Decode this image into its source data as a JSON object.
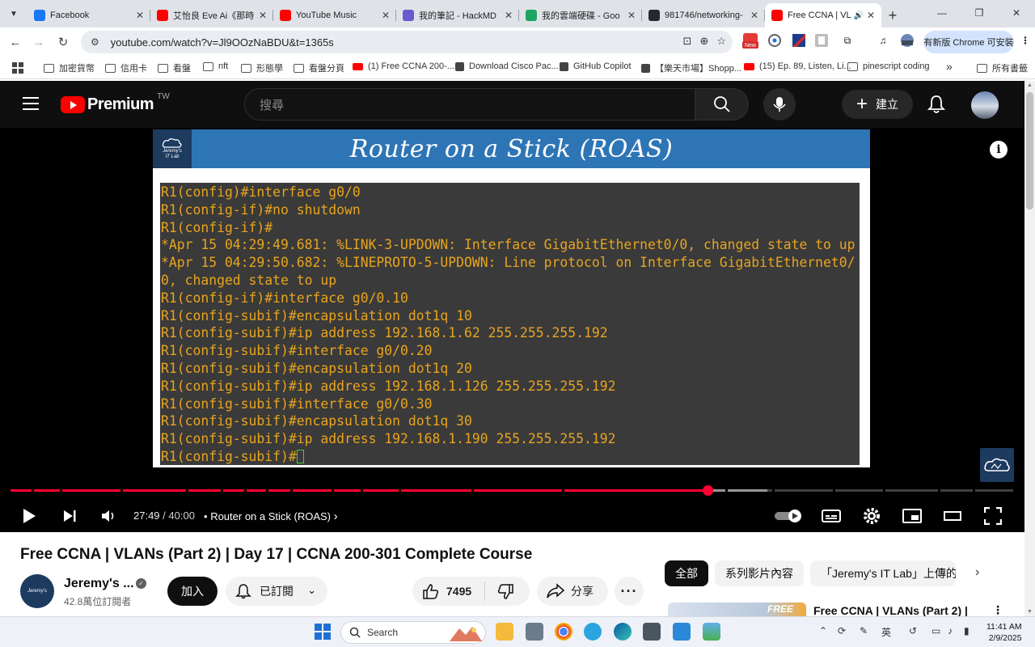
{
  "browser": {
    "tabs": [
      {
        "title": "Facebook",
        "icon": "facebook-icon",
        "color": "#1877f2"
      },
      {
        "title": "艾怡良 Eve Ai《那時",
        "icon": "youtube-icon",
        "color": "#ff0000"
      },
      {
        "title": "YouTube Music",
        "icon": "youtube-music-icon",
        "color": "#ff0000"
      },
      {
        "title": "我的筆記 - HackMD",
        "icon": "hackmd-icon",
        "color": "#6a5acd"
      },
      {
        "title": "我的雲端硬碟 - Goo",
        "icon": "google-drive-icon",
        "color": "#1fa463"
      },
      {
        "title": "981746/networking-",
        "icon": "github-icon",
        "color": "#24292f"
      },
      {
        "title": "Free CCNA | VLAN",
        "icon": "youtube-icon",
        "color": "#ff0000"
      }
    ],
    "url": "youtube.com/watch?v=Jl9OOzNaBDU&t=1365s",
    "update_button": "有新版 Chrome 可安裝",
    "ext_new_badge": "New",
    "bookmarks": [
      {
        "label": "加密貨幣",
        "type": "folder"
      },
      {
        "label": "信用卡",
        "type": "folder"
      },
      {
        "label": "看盤",
        "type": "folder"
      },
      {
        "label": "nft",
        "type": "folder"
      },
      {
        "label": "形態學",
        "type": "folder"
      },
      {
        "label": "看盤分頁",
        "type": "folder"
      },
      {
        "label": "(1) Free CCNA 200-...",
        "type": "youtube"
      },
      {
        "label": "Download Cisco Pac...",
        "type": "site"
      },
      {
        "label": "GitHub Copilot",
        "type": "site"
      },
      {
        "label": "【樂天市場】Shopp...",
        "type": "site"
      },
      {
        "label": "(15) Ep. 89, Listen, Li...",
        "type": "youtube"
      },
      {
        "label": "pinescript coding",
        "type": "folder"
      }
    ],
    "bookmarks_more": "»",
    "all_bookmarks": "所有書籤"
  },
  "youtube": {
    "logo_text": "Premium",
    "country_code": "TW",
    "search_placeholder": "搜尋",
    "create_label": "建立",
    "slide": {
      "logo_line1": "Jeremy's",
      "logo_line2": "IT Lab",
      "title": "Router on a Stick (ROAS)",
      "terminal_lines": [
        "R1(config)#interface g0/0",
        "R1(config-if)#no shutdown",
        "R1(config-if)#",
        "*Apr 15 04:29:49.681: %LINK-3-UPDOWN: Interface GigabitEthernet0/0, changed state to up",
        "*Apr 15 04:29:50.682: %LINEPROTO-5-UPDOWN: Line protocol on Interface GigabitEthernet0/",
        "0, changed state to up",
        "R1(config-if)#interface g0/0.10",
        "R1(config-subif)#encapsulation dot1q 10",
        "R1(config-subif)#ip address 192.168.1.62 255.255.255.192",
        "R1(config-subif)#interface g0/0.20",
        "R1(config-subif)#encapsulation dot1q 20",
        "R1(config-subif)#ip address 192.168.1.126 255.255.255.192",
        "R1(config-subif)#interface g0/0.30",
        "R1(config-subif)#encapsulation dot1q 30",
        "R1(config-subif)#ip address 192.168.1.190 255.255.255.192"
      ],
      "prompt_line": "R1(config-subif)#"
    },
    "player": {
      "current_time": "27:49",
      "duration": "40:00",
      "time_separator": " / ",
      "bullet": "•",
      "chapter": "Router on a Stick (ROAS)",
      "played_fraction": 0.6955,
      "chapter_marks": [
        0.021,
        0.049,
        0.11,
        0.175,
        0.21,
        0.233,
        0.255,
        0.279,
        0.32,
        0.349,
        0.387,
        0.46,
        0.55,
        0.713,
        0.76,
        0.82,
        0.87,
        0.925,
        0.96
      ]
    },
    "video": {
      "title": "Free CCNA | VLANs (Part 2) | Day 17 | CCNA 200-301 Complete Course",
      "channel": "Jeremy's ...",
      "subscribers": "42.8萬位訂閱者",
      "join_label": "加入",
      "subscribed_label": "已訂閱",
      "likes": "7495",
      "share_label": "分享"
    },
    "chips": [
      "全部",
      "系列影片內容",
      "「Jeremy's IT Lab」上傳的"
    ],
    "recommended": {
      "title": "Free CCNA | VLANs (Part 2) |",
      "thumb_text": "FREE"
    }
  },
  "taskbar": {
    "search_placeholder": "Search",
    "ime_label": "英",
    "time": "11:41 AM",
    "date": "2/9/2025"
  }
}
